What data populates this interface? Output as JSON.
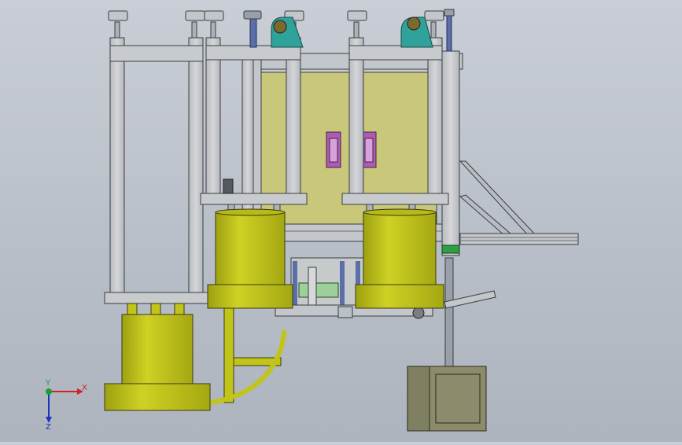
{
  "viewport": {
    "background_top": "#c9ced6",
    "background_bottom": "#aeb4be"
  },
  "model": {
    "frame_color": "#c8cbce",
    "frame_stroke": "#3a3d42",
    "cylinder_color": "#c2c41a",
    "panel_color": "#c9c77a",
    "handle_color": "#b05ab5",
    "clamp_color": "#2fa39a",
    "rod_color": "#5a6ea8",
    "motor_color": "#8c8c6c"
  },
  "triad": {
    "x_label": "X",
    "y_label": "Y",
    "z_label": "Z",
    "x_color": "#d0202a",
    "y_color": "#1aa030",
    "z_color": "#2030c0"
  }
}
